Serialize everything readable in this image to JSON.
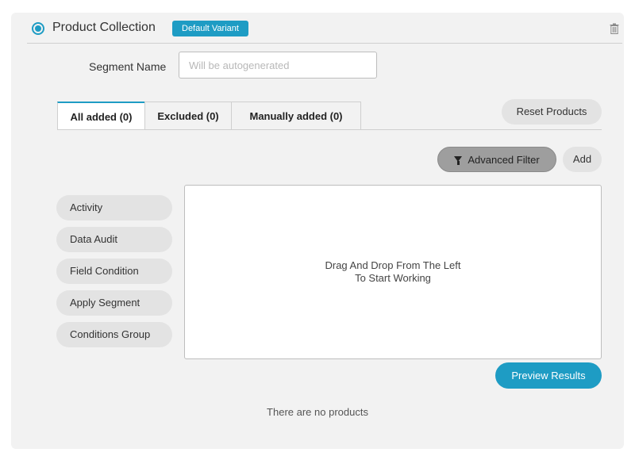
{
  "header": {
    "title": "Product Collection",
    "badge": "Default Variant"
  },
  "segment": {
    "label": "Segment Name",
    "value": "",
    "placeholder": "Will be autogenerated"
  },
  "tabs": [
    {
      "label": "All added (0)",
      "active": true
    },
    {
      "label": "Excluded (0)",
      "active": false
    },
    {
      "label": "Manually added (0)",
      "active": false
    }
  ],
  "toolbar": {
    "reset_label": "Reset Products",
    "filter_label": "Advanced Filter",
    "add_label": "Add"
  },
  "sidebar": {
    "items": [
      {
        "label": "Activity"
      },
      {
        "label": "Data Audit"
      },
      {
        "label": "Field Condition"
      },
      {
        "label": "Apply Segment"
      },
      {
        "label": "Conditions Group"
      }
    ]
  },
  "dropzone": {
    "line1": "Drag And Drop From The Left",
    "line2": "To Start Working"
  },
  "preview_label": "Preview Results",
  "empty_message": "There are no products",
  "colors": {
    "accent": "#1e9cc4",
    "card_bg": "#f2f2f2",
    "pill_bg": "#e3e3e3"
  }
}
